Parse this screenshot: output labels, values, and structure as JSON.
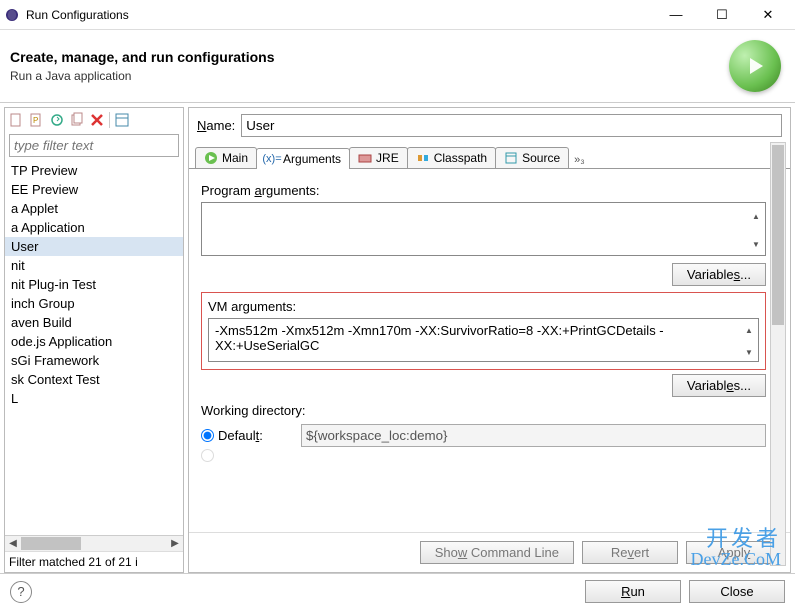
{
  "window": {
    "title": "Run Configurations",
    "header_title": "Create, manage, and run configurations",
    "header_sub": "Run a Java application"
  },
  "left": {
    "filter_placeholder": "type filter text",
    "items": [
      "TP Preview",
      "EE Preview",
      "a Applet",
      "a Application",
      "User",
      "nit",
      "nit Plug-in Test",
      "inch Group",
      "aven Build",
      "ode.js Application",
      "sGi Framework",
      "sk Context Test",
      "L"
    ],
    "selected_index": 4,
    "status": "Filter matched 21 of 21 i"
  },
  "right": {
    "name_label": "Name:",
    "name_value": "User",
    "tabs": {
      "main": "Main",
      "arguments": "Arguments",
      "jre": "JRE",
      "classpath": "Classpath",
      "source": "Source",
      "more": "»₃"
    },
    "program_args_label": "Program arguments:",
    "program_args_value": "",
    "vm_args_label": "VM arguments:",
    "vm_args_value": "-Xms512m -Xmx512m -Xmn170m -XX:SurvivorRatio=8 -XX:+PrintGCDetails -XX:+UseSerialGC",
    "variables_btn": "Variables...",
    "working_dir_label": "Working directory:",
    "default_label": "Default:",
    "default_value": "${workspace_loc:demo}",
    "buttons": {
      "show_cmd": "Show Command Line",
      "revert": "Revert",
      "apply": "Apply"
    }
  },
  "footer": {
    "run": "Run",
    "close": "Close"
  },
  "watermark": {
    "line1": "开发者",
    "line2": "DevZe.CoM"
  }
}
